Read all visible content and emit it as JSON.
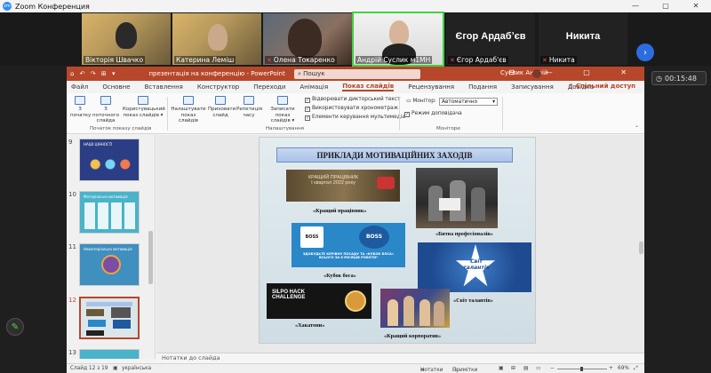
{
  "zoom": {
    "title": "Zoom Конференция",
    "window_controls": [
      "—",
      "▢",
      "✕"
    ],
    "participants": [
      {
        "name": "Вікторія Швачко",
        "muted": false,
        "video": true
      },
      {
        "name": "Катерина Леміш",
        "muted": false,
        "video": true
      },
      {
        "name": "Олена Токаренко",
        "muted": true,
        "video": true
      },
      {
        "name": "Андрій Суслик м1МН",
        "muted": false,
        "video": true,
        "active": true
      },
      {
        "name": "Єгор Ардаб'єв",
        "label": "Єгор Ардабʼєв",
        "muted": true,
        "video": false
      },
      {
        "name": "Никита",
        "label": "Никита",
        "muted": true,
        "video": false
      }
    ],
    "next_icon": "›",
    "timer": "00:15:48",
    "mic_icon": "✕"
  },
  "ppt": {
    "qat": "⌂ ↶ ↷ ⊞ ▾",
    "document_title": "презентація на конференцію  -  PowerPoint",
    "search_placeholder": "Пошук",
    "user": "Суслик Андрій",
    "window_controls": "⊟ — ▢ ✕",
    "tabs": [
      "Файл",
      "Основне",
      "Вставлення",
      "Конструктор",
      "Переходи",
      "Анімація",
      "Показ слайдів",
      "Рецензування",
      "Подання",
      "Записування",
      "Довідка"
    ],
    "active_tab": "Показ слайдів",
    "share_label": "Спільний доступ",
    "ribbon": {
      "buttons": [
        {
          "label": "З\nпочатку"
        },
        {
          "label": "З поточного\nслайда"
        },
        {
          "label": "Користувацький\nпоказ слайдів ▾"
        },
        {
          "label": "Налаштувати\nпоказ слайдів"
        },
        {
          "label": "Приховати\nслайд"
        },
        {
          "label": "Репетиція\nчасу"
        },
        {
          "label": "Записати показ\nслайдів ▾"
        }
      ],
      "checkboxes": [
        {
          "label": "Відворювати дикторський текст",
          "checked": true
        },
        {
          "label": "Використовувати хронометраж",
          "checked": true
        },
        {
          "label": "Елементи керування мультимедіа",
          "checked": true
        },
        {
          "label": "Режим доповідача",
          "checked": true
        }
      ],
      "monitor_label": "Монітор:",
      "monitor_value": "Автоматично",
      "groups": [
        "Початок показу слайдів",
        "Налаштування",
        "Монітори"
      ]
    },
    "thumbnails": [
      {
        "num": "9",
        "title": "НАШІ ЦІННОСТІ"
      },
      {
        "num": "10",
        "title": "Матеріальна мотивація"
      },
      {
        "num": "11",
        "title": "Нематеріальна мотивація"
      },
      {
        "num": "12",
        "title": "Приклади мотиваційних заходів",
        "selected": true
      },
      {
        "num": "13",
        "title": ""
      }
    ],
    "slide": {
      "title": "ПРИКЛАДИ МОТИВАЦІЙНИХ ЗАХОДІВ",
      "banner_text": "КРАЩИЙ ПРАЦІВНИК\nІ квартал 2022 року",
      "mug_text": "BOSS",
      "boss_caption": "ЗДОБУДЬТЕ КЕРІВНУ ПОСАДУ ТА «КУБОК БОСА»\nВСЬОГО ЗА 6 МІСЯЦІВ РОБОТИ*",
      "hack_text": "SILPO HACK\nCHALLENGE",
      "star_text": "Світ\nталантів",
      "captions": [
        "«Кращий працівник»",
        "«Битва професіоналів»",
        "«Кубок боса»",
        "«Світ талантів»",
        "«Хакатони»",
        "«Кращий корпоратив»"
      ]
    },
    "notes_placeholder": "Нотатки до слайда",
    "status": {
      "slide": "Слайд 12 з 19",
      "language": "українська",
      "notes": "Нотатки",
      "comments": "Примітки",
      "zoom": "69%"
    }
  },
  "colors": {
    "ppt_accent": "#b7472a",
    "zoom_blue": "#2d8cff",
    "active_speaker": "#42d142"
  }
}
